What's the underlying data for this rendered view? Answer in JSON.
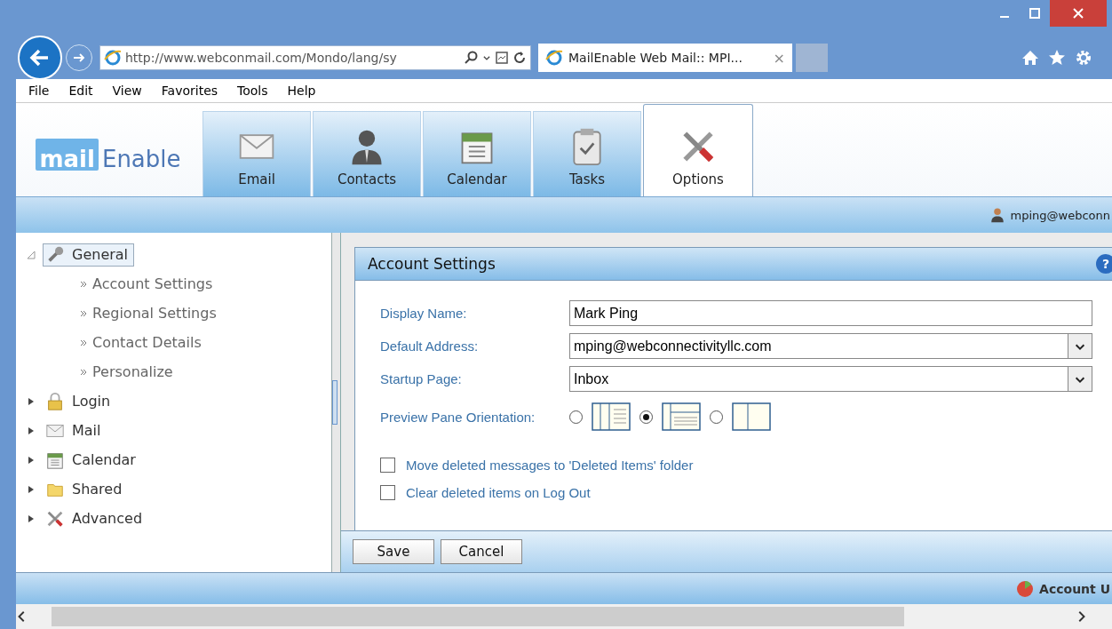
{
  "browser": {
    "address": "http://www.webconmail.com/Mondo/lang/sy",
    "tab": {
      "title": "MailEnable Web Mail:: MPI...",
      "close": "×",
      "selected": true
    },
    "menu": [
      "File",
      "Edit",
      "View",
      "Favorites",
      "Tools",
      "Help"
    ]
  },
  "app": {
    "logo": {
      "mail": "mail",
      "enable": "Enable"
    },
    "nav_tabs": [
      {
        "label": "Email",
        "selected": false
      },
      {
        "label": "Contacts",
        "selected": false
      },
      {
        "label": "Calendar",
        "selected": false
      },
      {
        "label": "Tasks",
        "selected": false
      },
      {
        "label": "Options",
        "selected": true
      }
    ],
    "user": "mping@webconn",
    "tree": [
      {
        "label": "General",
        "expanded": true,
        "selected": true,
        "children": [
          {
            "label": "Account Settings"
          },
          {
            "label": "Regional Settings"
          },
          {
            "label": "Contact Details"
          },
          {
            "label": "Personalize"
          }
        ]
      },
      {
        "label": "Login",
        "expanded": false,
        "selected": false
      },
      {
        "label": "Mail",
        "expanded": false,
        "selected": false
      },
      {
        "label": "Calendar",
        "expanded": false,
        "selected": false
      },
      {
        "label": "Shared",
        "expanded": false,
        "selected": false
      },
      {
        "label": "Advanced",
        "expanded": false,
        "selected": false
      }
    ],
    "panel": {
      "title": "Account Settings",
      "help": "?",
      "fields": [
        {
          "kind": "text",
          "label": "Display Name:",
          "value": "Mark Ping"
        },
        {
          "kind": "select",
          "label": "Default Address:",
          "value": "mping@webconnectivityllc.com"
        },
        {
          "kind": "select",
          "label": "Startup Page:",
          "value": "Inbox"
        }
      ],
      "preview_pane": {
        "label": "Preview Pane Orientation:",
        "options": [
          {
            "selected": false
          },
          {
            "selected": true
          },
          {
            "selected": false
          }
        ]
      },
      "checkboxes": [
        {
          "label": "Move deleted messages to 'Deleted Items' folder",
          "checked": false
        },
        {
          "label": "Clear deleted items on Log Out",
          "checked": false
        }
      ],
      "buttons": [
        "Save",
        "Cancel"
      ]
    },
    "status": "Account U"
  }
}
